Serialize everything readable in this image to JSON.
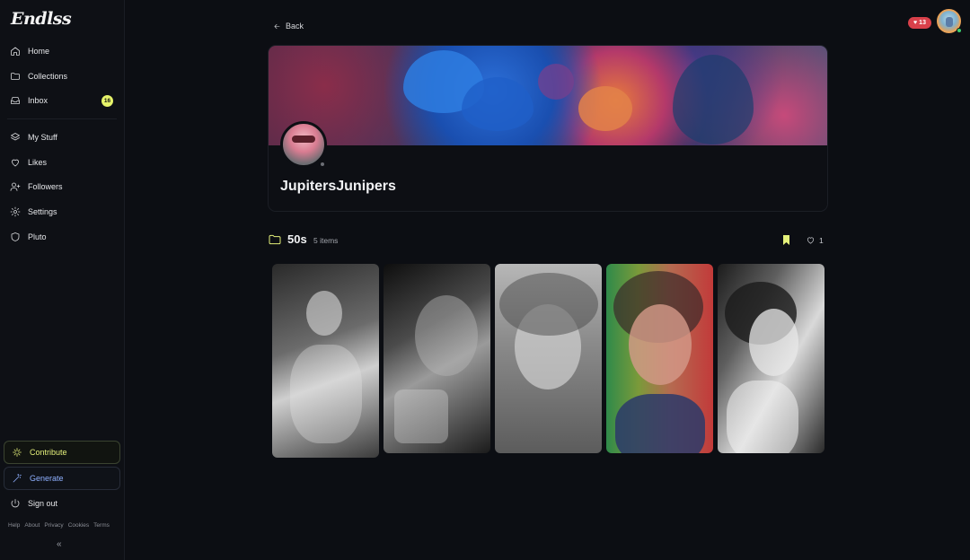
{
  "app": {
    "logo_text": "Endlss"
  },
  "sidebar": {
    "items": [
      {
        "label": "Home",
        "icon": "home-icon"
      },
      {
        "label": "Collections",
        "icon": "folder-icon"
      },
      {
        "label": "Inbox",
        "icon": "inbox-icon",
        "badge": "16"
      },
      {
        "label": "My Stuff",
        "icon": "layers-icon"
      },
      {
        "label": "Likes",
        "icon": "heart-icon"
      },
      {
        "label": "Followers",
        "icon": "user-plus-icon"
      },
      {
        "label": "Settings",
        "icon": "gear-icon"
      },
      {
        "label": "Pluto",
        "icon": "shield-icon"
      }
    ],
    "contribute_label": "Contribute",
    "generate_label": "Generate",
    "signout_label": "Sign out",
    "footer_links": [
      "Help",
      "About",
      "Privacy",
      "Cookies",
      "Terms"
    ],
    "collapse_glyph": "«"
  },
  "header": {
    "likes_count": "13",
    "accent_like": "#d9404a",
    "accent_brand": "#e4f07a"
  },
  "main": {
    "back_label": "Back",
    "profile": {
      "username": "JupitersJunipers"
    },
    "collection": {
      "title": "50s",
      "count_label": "5 items",
      "likes": "1",
      "images": [
        {
          "name": "thumbnail-1",
          "style": "grayscale portrait with cigarette"
        },
        {
          "name": "thumbnail-2",
          "style": "grayscale portrait with glass"
        },
        {
          "name": "thumbnail-3",
          "style": "grayscale portrait wide eyes"
        },
        {
          "name": "thumbnail-4",
          "style": "color portrait red lips"
        },
        {
          "name": "thumbnail-5",
          "style": "grayscale portrait profile"
        }
      ]
    }
  }
}
